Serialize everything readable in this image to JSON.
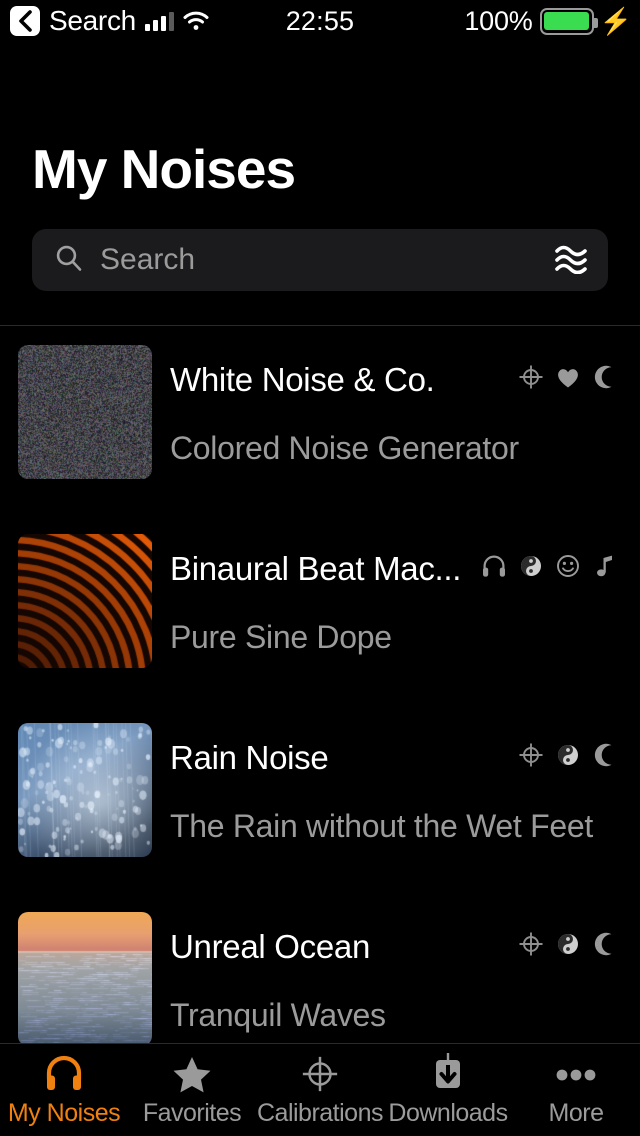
{
  "status_bar": {
    "back_label": "Search",
    "back_icon": "chevron-left-icon",
    "signal_icon": "cellular-signal-icon",
    "wifi_icon": "wifi-icon",
    "time": "22:55",
    "battery_percent": "100%",
    "battery_icon": "battery-full-icon",
    "charging_icon": "lightning-bolt-icon",
    "battery_fill_color": "#3add4f"
  },
  "header": {
    "title": "My Noises"
  },
  "search": {
    "placeholder": "Search",
    "value": "",
    "search_icon": "search-icon",
    "filter_icon": "waves-icon"
  },
  "list": {
    "rows": [
      {
        "title": "White Noise & Co.",
        "subtitle": "Colored Noise Generator",
        "thumb": "white-noise-static-thumbnail",
        "icons": [
          "crosshair-icon",
          "heart-icon",
          "moon-icon"
        ]
      },
      {
        "title": "Binaural Beat Mac...",
        "subtitle": "Pure Sine Dope",
        "thumb": "binaural-rings-thumbnail",
        "icons": [
          "headphones-icon",
          "yin-yang-icon",
          "smiley-icon",
          "music-note-icon"
        ]
      },
      {
        "title": "Rain Noise",
        "subtitle": "The Rain without the Wet Feet",
        "thumb": "rain-window-thumbnail",
        "icons": [
          "crosshair-icon",
          "yin-yang-icon",
          "moon-icon"
        ]
      },
      {
        "title": "Unreal Ocean",
        "subtitle": "Tranquil Waves",
        "thumb": "sunset-ocean-thumbnail",
        "icons": [
          "crosshair-icon",
          "yin-yang-icon",
          "moon-icon"
        ]
      }
    ]
  },
  "tabbar": {
    "accent_color": "#f08010",
    "inactive_color": "#9b9b9b",
    "tabs": [
      {
        "label": "My Noises",
        "icon": "headphones-icon",
        "active": true
      },
      {
        "label": "Favorites",
        "icon": "star-icon",
        "active": false
      },
      {
        "label": "Calibrations",
        "icon": "crosshair-icon",
        "active": false
      },
      {
        "label": "Downloads",
        "icon": "download-icon",
        "active": false
      },
      {
        "label": "More",
        "icon": "ellipsis-icon",
        "active": false
      }
    ]
  }
}
